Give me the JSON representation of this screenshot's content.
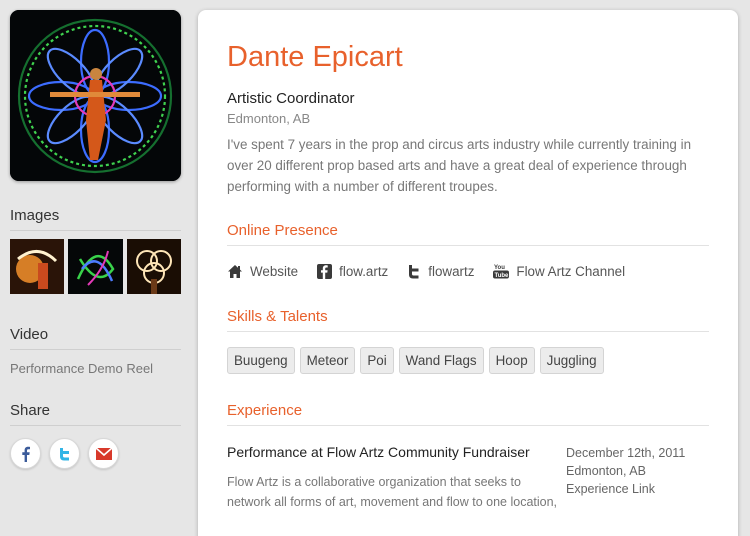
{
  "profile": {
    "name": "Dante Epicart",
    "role": "Artistic Coordinator",
    "location": "Edmonton, AB",
    "bio": "I've spent 7 years in the prop and circus arts industry while currently training in over 20 different prop based arts and have a great deal of experience through performing with a number of different troupes."
  },
  "sidebar": {
    "images_title": "Images",
    "video_title": "Video",
    "video_link": "Performance Demo Reel",
    "share_title": "Share",
    "share_icons": [
      "facebook-icon",
      "twitter-icon",
      "email-icon"
    ]
  },
  "online_presence": {
    "title": "Online Presence",
    "links": [
      {
        "label": "Website",
        "icon": "home-icon"
      },
      {
        "label": "flow.artz",
        "icon": "facebook-icon"
      },
      {
        "label": "flowartz",
        "icon": "twitter-icon"
      },
      {
        "label": "Flow Artz Channel",
        "icon": "youtube-icon"
      }
    ]
  },
  "skills": {
    "title": "Skills & Talents",
    "tags": [
      "Buugeng",
      "Meteor",
      "Poi",
      "Wand Flags",
      "Hoop",
      "Juggling"
    ]
  },
  "experience": {
    "title": "Experience",
    "items": [
      {
        "title": "Performance at Flow Artz Community Fundraiser",
        "description": "Flow Artz is a collaborative organization that seeks to network all forms of art, movement and flow to one location,",
        "date": "December 12th, 2011",
        "location": "Edmonton, AB",
        "link": "Experience Link"
      }
    ]
  },
  "colors": {
    "accent": "#e8612c",
    "background": "#e6e6e6",
    "card": "#ffffff"
  }
}
